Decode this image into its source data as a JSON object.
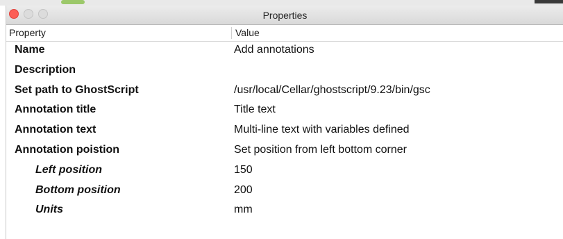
{
  "window": {
    "title": "Properties"
  },
  "table": {
    "headers": {
      "property": "Property",
      "value": "Value"
    },
    "rows": [
      {
        "property": "Name",
        "value": "Add annotations"
      },
      {
        "property": "Description",
        "value": ""
      },
      {
        "property": "Set path to GhostScript",
        "value": "/usr/local/Cellar/ghostscript/9.23/bin/gsc"
      },
      {
        "property": "Annotation title",
        "value": "Title text"
      },
      {
        "property": "Annotation text",
        "value": "Multi-line text with variables defined"
      },
      {
        "property": "Annotation poistion",
        "value": "Set position from left bottom corner"
      },
      {
        "property": "Left position",
        "value": "150"
      },
      {
        "property": "Bottom position",
        "value": "200"
      },
      {
        "property": "Units",
        "value": "mm"
      }
    ]
  },
  "colors": {
    "close_button": "#fc5f57",
    "inactive_button": "#dcdcdc"
  }
}
